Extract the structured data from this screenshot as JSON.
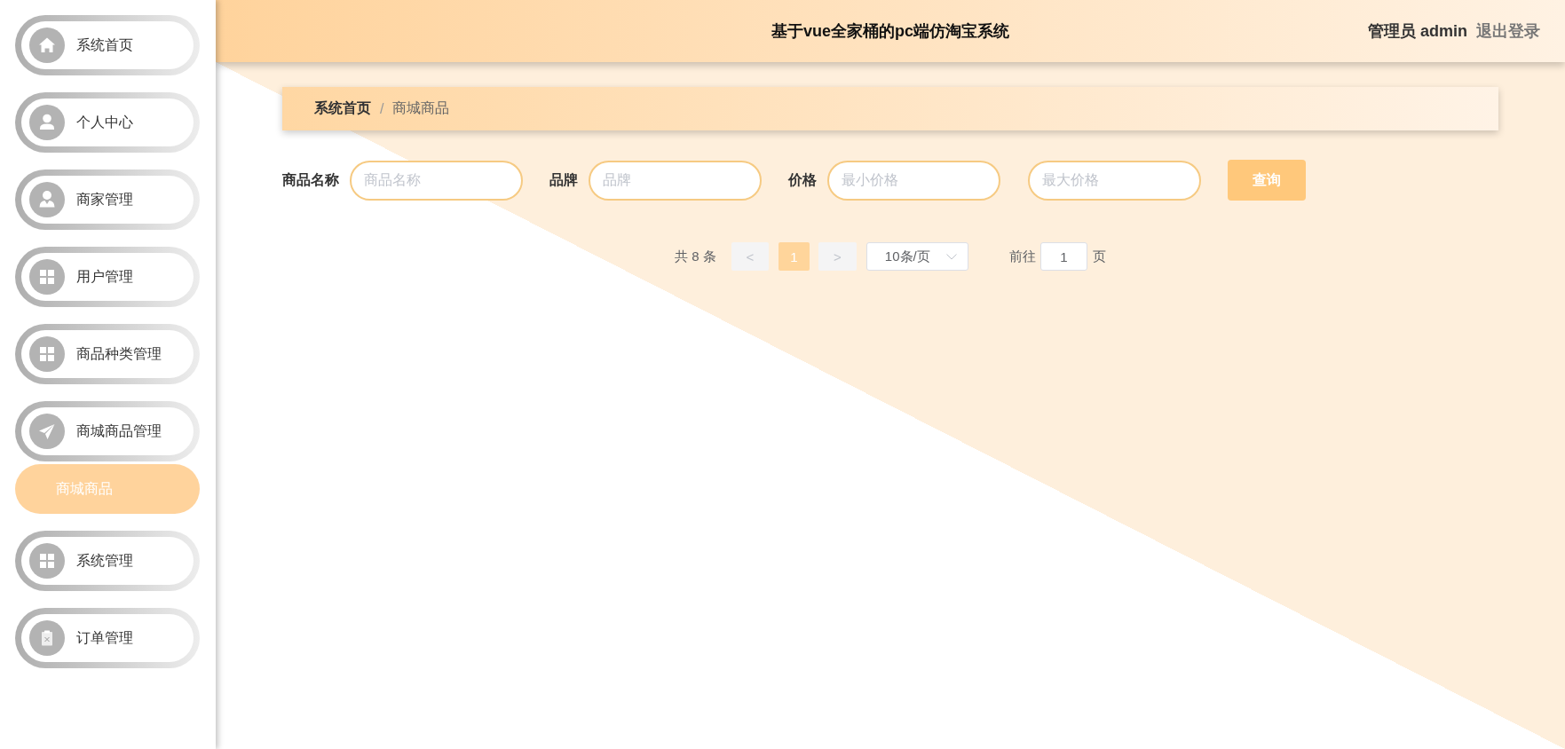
{
  "sidebar": {
    "items": [
      {
        "label": "系统首页",
        "selected": false
      },
      {
        "label": "个人中心",
        "selected": false
      },
      {
        "label": "商家管理",
        "selected": false
      },
      {
        "label": "用户管理",
        "selected": false
      },
      {
        "label": "商品种类管理",
        "selected": false
      },
      {
        "label": "商城商品管理",
        "selected": false,
        "expanded": true,
        "children": [
          {
            "label": "商城商品",
            "selected": true
          }
        ]
      },
      {
        "label": "系统管理",
        "selected": false
      },
      {
        "label": "订单管理",
        "selected": false
      }
    ]
  },
  "header": {
    "title": "基于vue全家桶的pc端仿淘宝系统",
    "user": "管理员 admin",
    "logout": "退出登录"
  },
  "breadcrumb": [
    {
      "label": "系统首页",
      "kind": "link"
    },
    {
      "label": "/",
      "kind": "separator"
    },
    {
      "label": "商城商品",
      "kind": "current"
    }
  ],
  "filters": [
    {
      "label": "商品名称",
      "fields": [
        {
          "placeholder": "商品名称"
        }
      ]
    },
    {
      "label": "品牌",
      "fields": [
        {
          "placeholder": "品牌"
        }
      ]
    },
    {
      "label": "价格",
      "fields": [
        {
          "placeholder": "最小价格"
        },
        {
          "placeholder": "最大价格"
        }
      ]
    }
  ],
  "search_button": "查询",
  "pagination": {
    "total": "共 8 条",
    "prev": {
      "label": "<",
      "disabled": true
    },
    "pages": [
      {
        "label": "1",
        "selected": true
      }
    ],
    "next": {
      "label": ">",
      "disabled": true
    },
    "page_size": "10条/页",
    "goto_label": "前往",
    "goto_value": "1",
    "goto_suffix": "页"
  }
}
